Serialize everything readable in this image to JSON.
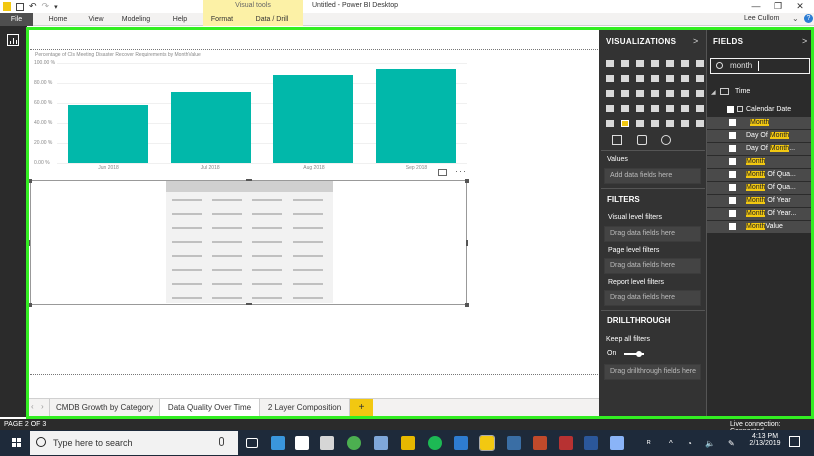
{
  "titlebar": {
    "visual_tools_label": "Visual tools",
    "title": "Untitled - Power BI Desktop",
    "user": "Lee Cullom",
    "window_controls": [
      "—",
      "❐",
      "✕"
    ]
  },
  "ribbon": {
    "tabs": [
      "File",
      "Home",
      "View",
      "Modeling",
      "Help",
      "Format",
      "Data / Drill"
    ],
    "expand_glyph": "⌄",
    "help_glyph": "?"
  },
  "chart": {
    "title": "Percentage of CIs Meeting Disaster Recover Requirements by MonthValue",
    "more_glyph": "···"
  },
  "chart_data": {
    "type": "bar",
    "title": "Percentage of CIs Meeting Disaster Recover Requirements by MonthValue",
    "categories": [
      "Jun 2018",
      "Jul 2018",
      "Aug 2018",
      "Sep 2018"
    ],
    "values": [
      58,
      71,
      88,
      94
    ],
    "ylim": [
      0,
      100
    ],
    "yticks": [
      "0.00 %",
      "20.00 %",
      "40.00 %",
      "60.00 %",
      "80.00 %",
      "100.00 %"
    ],
    "ytick_values": [
      0,
      20,
      40,
      60,
      80,
      100
    ],
    "colors": {
      "bar": "#01b8aa"
    },
    "grid": true
  },
  "page_tabs": {
    "nav_prev": "‹",
    "nav_next": "›",
    "tabs": [
      "CMDB Growth by Category",
      "Data Quality Over Time",
      "2 Layer Composition"
    ],
    "active_index": 1,
    "add_label": "+"
  },
  "visualizations": {
    "header": "VISUALIZATIONS",
    "chevron": ">",
    "values_label": "Values",
    "values_placeholder": "Add data fields here",
    "filters_header": "FILTERS",
    "visual_level_filters": "Visual level filters",
    "visual_drag": "Drag data fields here",
    "page_level_filters": "Page level filters",
    "page_drag": "Drag data fields here",
    "report_level_filters": "Report level filters",
    "report_drag": "Drag data fields here",
    "drillthrough_header": "DRILLTHROUGH",
    "keep_all_filters": "Keep all filters",
    "toggle_state": "On",
    "drillthrough_drag": "Drag drillthrough fields here"
  },
  "fields": {
    "header": "FIELDS",
    "chevron": ">",
    "search_value": "month",
    "table_name": "Time",
    "items": [
      {
        "pre": "Calendar Date",
        "match": "",
        "post": ""
      },
      {
        "pre": "",
        "match": "Month",
        "post": ""
      },
      {
        "pre": "Day Of ",
        "match": "Month",
        "post": ""
      },
      {
        "pre": "Day Of ",
        "match": "Month",
        "post": "..."
      },
      {
        "pre": "",
        "match": "Month",
        "post": ""
      },
      {
        "pre": "",
        "match": "Month",
        "post": " Of Qua..."
      },
      {
        "pre": "",
        "match": "Month",
        "post": " Of Qua..."
      },
      {
        "pre": "",
        "match": "Month",
        "post": " Of Year"
      },
      {
        "pre": "",
        "match": "Month",
        "post": " Of Year..."
      },
      {
        "pre": "",
        "match": "Month",
        "post": "Value"
      }
    ]
  },
  "statusbar": {
    "page": "PAGE 2 OF 3",
    "connection": "Live connection: Connected"
  },
  "taskbar": {
    "search_placeholder": "Type here to search",
    "time": "4:13 PM",
    "date": "2/13/2019",
    "tray_glyphs": [
      "ᴿ",
      "^",
      "◔",
      "🔈",
      "✎"
    ]
  }
}
